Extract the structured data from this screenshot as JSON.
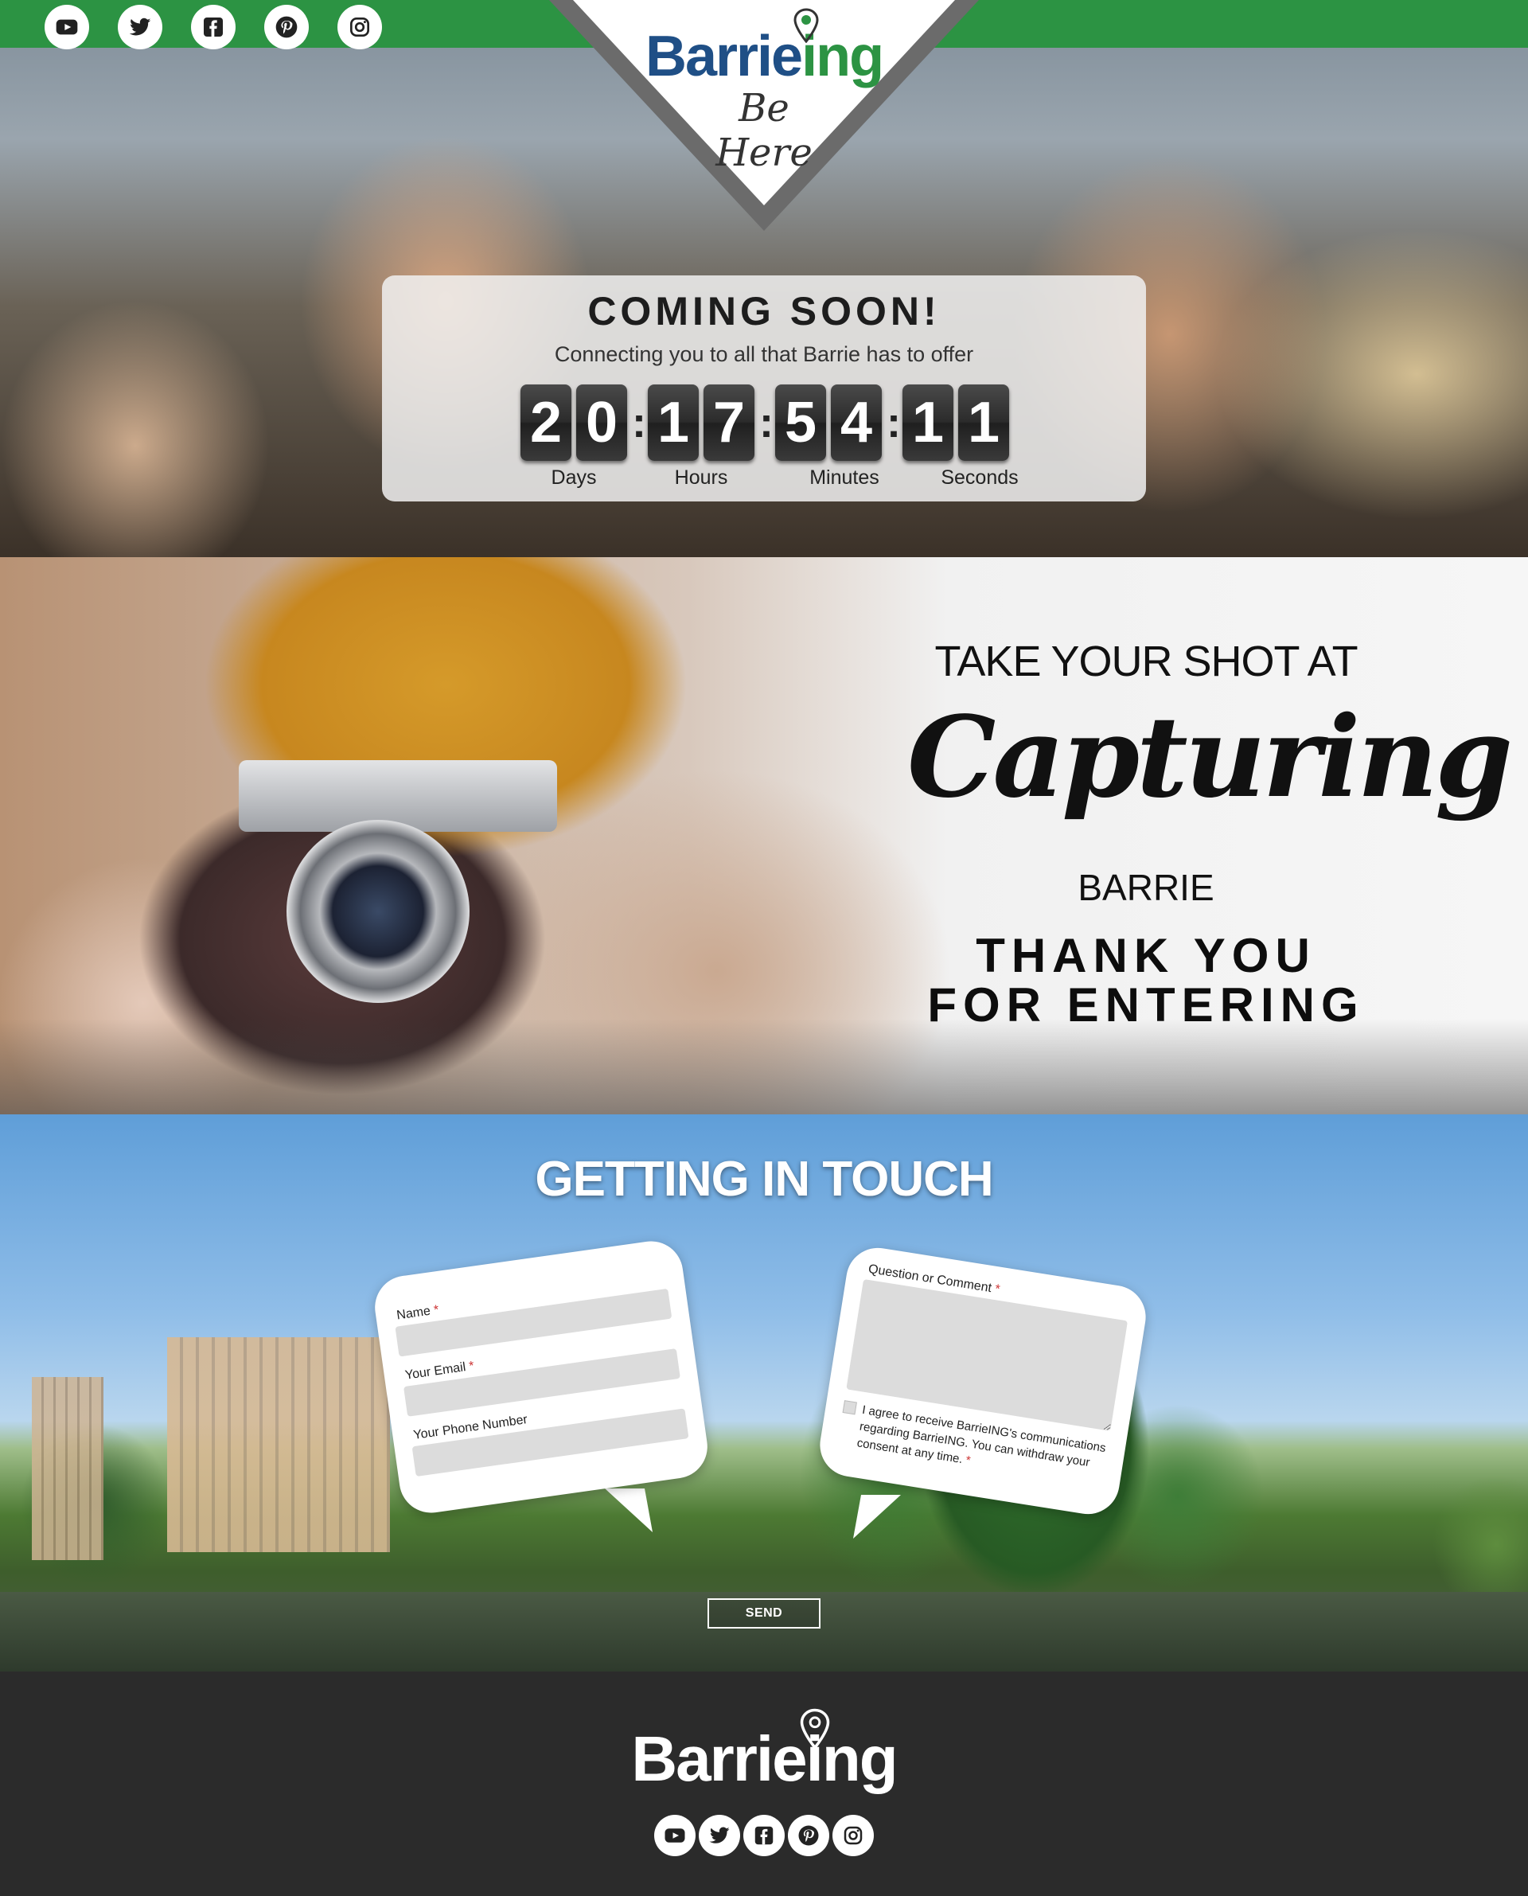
{
  "brand": {
    "name_main": "Barrie",
    "name_accent": "ing",
    "tagline": "Be Here",
    "colors": {
      "green": "#2c9343",
      "blue": "#1f4f86",
      "dark": "#2b2b2b"
    }
  },
  "social": [
    {
      "name": "youtube-icon"
    },
    {
      "name": "twitter-icon"
    },
    {
      "name": "facebook-icon"
    },
    {
      "name": "pinterest-icon"
    },
    {
      "name": "instagram-icon"
    }
  ],
  "countdown": {
    "title": "COMING SOON!",
    "subtitle": "Connecting you to all that Barrie has to offer",
    "digits": [
      "2",
      "0",
      "1",
      "7",
      "5",
      "4",
      "1",
      "1"
    ],
    "separator": ":",
    "units": [
      "Days",
      "Hours",
      "Minutes",
      "Seconds"
    ]
  },
  "promo": {
    "line1": "TAKE YOUR SHOT AT",
    "script": "Capturing",
    "line3": "BARRIE",
    "thanks_line1": "THANK YOU",
    "thanks_line2": "FOR ENTERING"
  },
  "contact": {
    "title": "GETTING IN TOUCH",
    "fields": {
      "name_label": "Name",
      "email_label": "Your Email",
      "phone_label": "Your Phone Number",
      "comment_label": "Question or Comment",
      "required_mark": "*"
    },
    "consent": "I agree to receive BarrieING's communications regarding BarrieING. You can withdraw your consent at any time.",
    "send_label": "SEND"
  },
  "footer": {
    "name_main": "Barrie",
    "name_accent": "ing"
  }
}
